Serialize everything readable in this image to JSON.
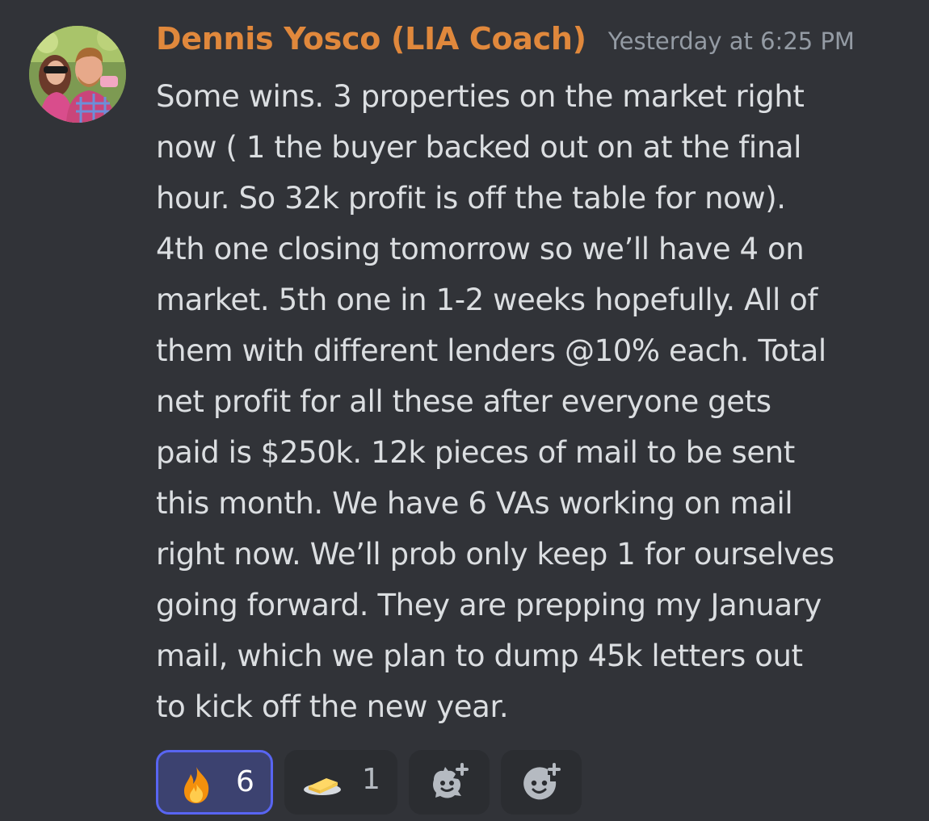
{
  "message": {
    "author": "Dennis Yosco (LIA Coach)",
    "author_color": "#e0883c",
    "timestamp": "Yesterday at 6:25 PM",
    "lines": [
      "Some wins. 3 properties on the market right",
      "now ( 1 the buyer backed out on at the final",
      "hour. So 32k profit is off the table for now).",
      "4th one closing tomorrow so we’ll have 4 on",
      "market. 5th one in 1-2 weeks hopefully. All of",
      "them with different lenders @10% each. Total",
      "net profit for all these after everyone gets",
      "paid is $250k. 12k pieces of mail to be sent",
      "this month. We have 6 VAs working on mail",
      "right now. We’ll prob only keep 1 for ourselves",
      "going forward. They are prepping my January",
      "mail, which we plan to dump 45k letters out",
      "to kick off the new year."
    ]
  },
  "reactions": [
    {
      "emoji": "fire-icon",
      "count": "6",
      "active": true
    },
    {
      "emoji": "butter-icon",
      "count": "1",
      "active": false
    },
    {
      "emoji": "add-super-reaction-icon"
    },
    {
      "emoji": "add-reaction-icon"
    }
  ],
  "colors": {
    "background": "#313338",
    "text": "#dbdee1",
    "muted": "#949ba4",
    "active_reaction_border": "#5865f2"
  }
}
